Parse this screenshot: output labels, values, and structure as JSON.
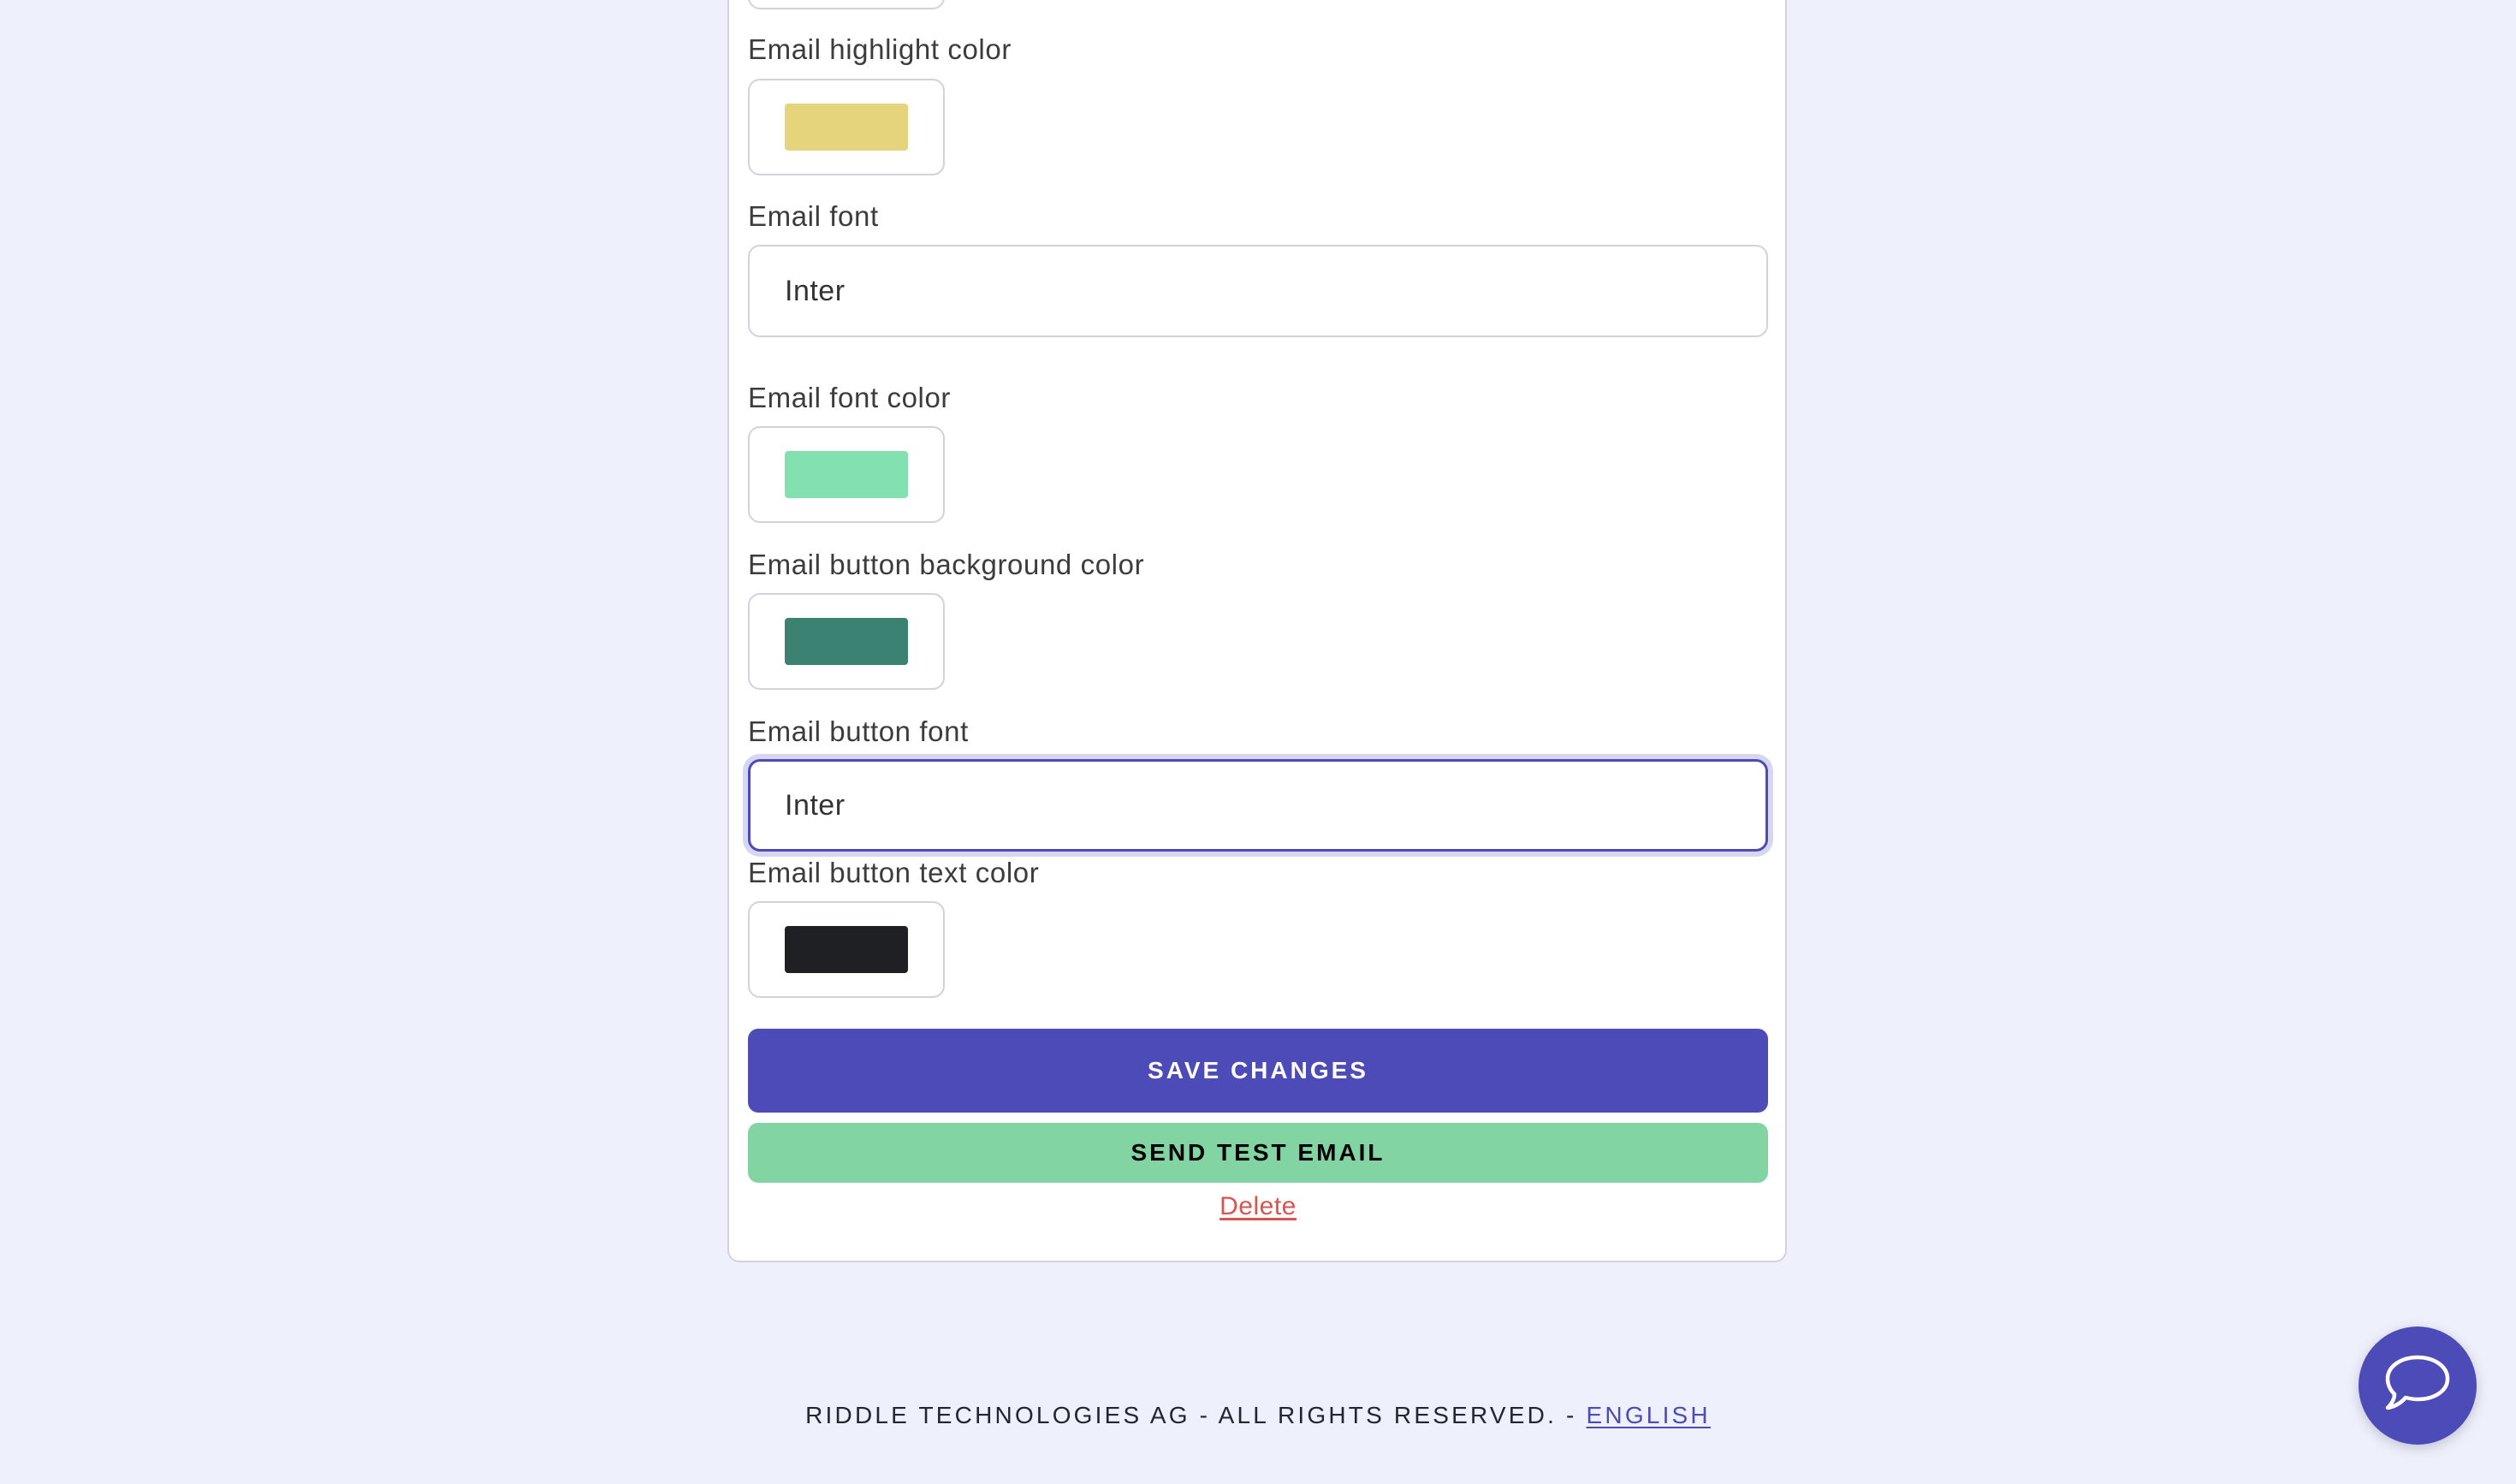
{
  "form": {
    "previous_field_partial": true,
    "fields": [
      {
        "label": "Email highlight color",
        "type": "color",
        "value": "#e6d47c"
      },
      {
        "label": "Email font",
        "type": "text",
        "value": "Inter"
      },
      {
        "label": "Email font color",
        "type": "color",
        "value": "#83e0b0"
      },
      {
        "label": "Email button background color",
        "type": "color",
        "value": "#3c8272"
      },
      {
        "label": "Email button font",
        "type": "text",
        "value": "Inter",
        "focused": true
      },
      {
        "label": "Email button text color",
        "type": "color",
        "value": "#1f2024"
      }
    ],
    "save_label": "SAVE CHANGES",
    "send_test_label": "SEND TEST EMAIL",
    "delete_label": "Delete"
  },
  "footer": {
    "text": "RIDDLE TECHNOLOGIES AG - ALL RIGHTS RESERVED. - ",
    "language_link": "ENGLISH"
  },
  "chat_widget": {
    "icon": "chat-bubble-icon"
  },
  "colors": {
    "accent": "#4c4bb8",
    "secondary_button": "#82d4a2",
    "danger": "#d9534f",
    "page_background": "#eef0fb"
  }
}
